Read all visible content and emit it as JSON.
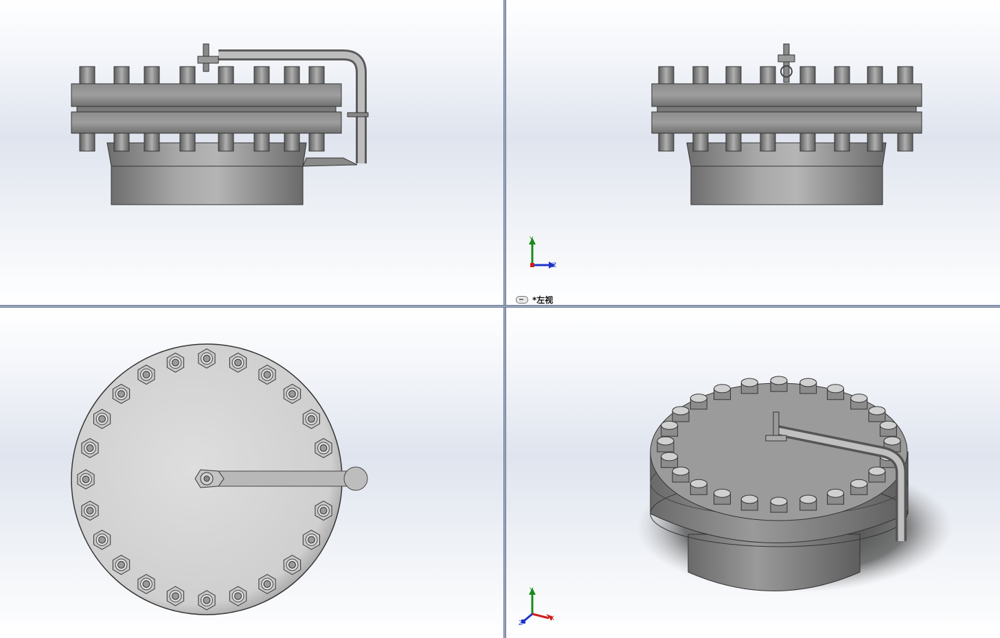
{
  "viewports": {
    "top_right": {
      "view_label": "*左视"
    },
    "triads": {
      "left_view": {
        "y": "Y",
        "z": "Z"
      },
      "iso_view": {
        "y": "Y",
        "x": "X",
        "z": "Z"
      }
    }
  },
  "colors": {
    "steel": "#8f8f8f",
    "steel_dark": "#5a5a5a",
    "steel_light": "#c9c9c9",
    "axis_x": "#d01c1c",
    "axis_y": "#1a8a1a",
    "axis_z": "#1c34c8"
  }
}
